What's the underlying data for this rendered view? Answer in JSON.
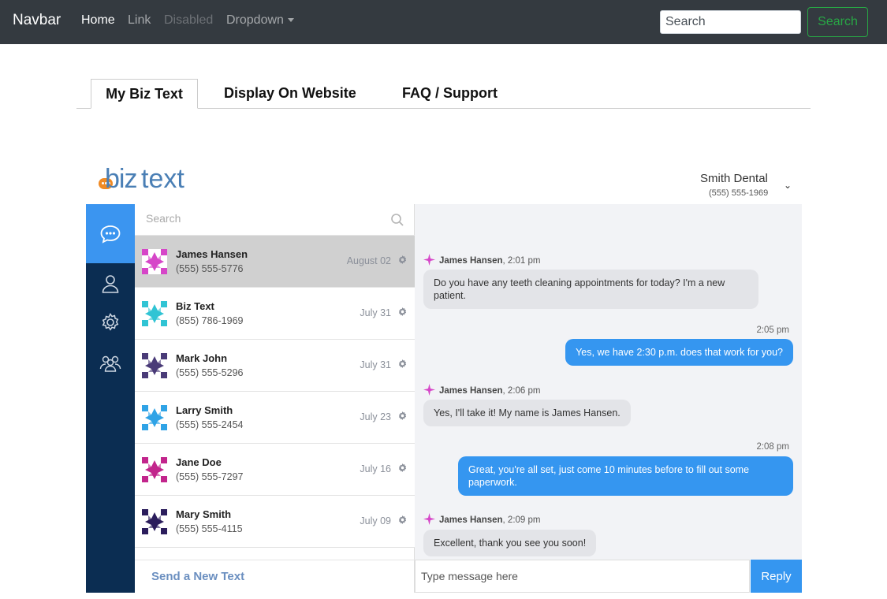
{
  "navbar": {
    "brand": "Navbar",
    "links": {
      "home": "Home",
      "link": "Link",
      "disabled": "Disabled",
      "dropdown": "Dropdown"
    },
    "search_placeholder": "Search",
    "search_button": "Search"
  },
  "tabs": {
    "my_biz_text": "My Biz Text",
    "display_on_website": "Display On Website",
    "faq_support": "FAQ / Support"
  },
  "app": {
    "logo": {
      "biz": "biz",
      "text": "text"
    },
    "account": {
      "name": "Smith Dental",
      "phone": "(555) 555-1969"
    },
    "search_placeholder": "Search",
    "conversations": [
      {
        "name": "James Hansen",
        "phone": "(555) 555-5776",
        "date": "August 02",
        "color": "#d646c8"
      },
      {
        "name": "Biz Text",
        "phone": "(855) 786-1969",
        "date": "July 31",
        "color": "#30c4d4"
      },
      {
        "name": "Mark John",
        "phone": "(555) 555-5296",
        "date": "July 31",
        "color": "#4a3b78"
      },
      {
        "name": "Larry Smith",
        "phone": "(555) 555-2454",
        "date": "July 23",
        "color": "#2fa3e6"
      },
      {
        "name": "Jane Doe",
        "phone": "(555) 555-7297",
        "date": "July 16",
        "color": "#c2258c"
      },
      {
        "name": "Mary Smith",
        "phone": "(555) 555-4115",
        "date": "July 09",
        "color": "#2b1d5c"
      }
    ],
    "send_new": "Send a New Text",
    "messages": [
      {
        "from": "James Hansen",
        "time": ", 2:01 pm",
        "text": "Do you have any teeth cleaning appointments for today? I'm a new patient."
      },
      {
        "time": "2:05 pm",
        "text": "Yes, we have 2:30 p.m. does that work for you?"
      },
      {
        "from": "James Hansen",
        "time": ", 2:06 pm",
        "text": "Yes, I'll take it! My name is James Hansen."
      },
      {
        "time": "2:08 pm",
        "text": "Great, you're all set, just come 10 minutes before to fill out some paperwork."
      },
      {
        "from": "James Hansen",
        "time": ", 2:09 pm",
        "text": "Excellent, thank you see you soon!"
      }
    ],
    "composer_placeholder": "Type message here",
    "reply": "Reply"
  },
  "colors": {
    "navbar": "#343a40",
    "rail": "#0b2d52",
    "accent": "#3596f0",
    "success": "#28a745"
  }
}
